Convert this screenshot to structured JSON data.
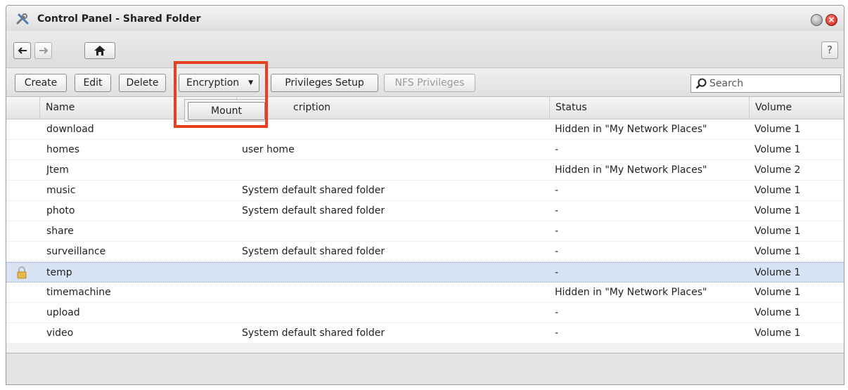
{
  "window": {
    "title": "Control Panel - Shared Folder"
  },
  "navigation": {
    "back": "back",
    "forward": "forward",
    "home": "home",
    "help": "?"
  },
  "toolbar": {
    "create": "Create",
    "edit": "Edit",
    "delete": "Delete",
    "encryption": "Encryption",
    "privileges_setup": "Privileges Setup",
    "nfs_privileges": "NFS Privileges",
    "search_placeholder": "Search"
  },
  "encryption_menu": {
    "mount": "Mount"
  },
  "table": {
    "columns": {
      "name": "Name",
      "description": "Description",
      "description_visible": "cription",
      "status": "Status",
      "volume": "Volume"
    },
    "rows": [
      {
        "name": "download",
        "description": "",
        "status": "Hidden in \"My Network Places\"",
        "volume": "Volume 1"
      },
      {
        "name": "homes",
        "description": "user home",
        "status": "-",
        "volume": "Volume 1"
      },
      {
        "name": "Jtem",
        "description": "",
        "status": "Hidden in \"My Network Places\"",
        "volume": "Volume 2"
      },
      {
        "name": "music",
        "description": "System default shared folder",
        "status": "-",
        "volume": "Volume 1"
      },
      {
        "name": "photo",
        "description": "System default shared folder",
        "status": "-",
        "volume": "Volume 1"
      },
      {
        "name": "share",
        "description": "",
        "status": "-",
        "volume": "Volume 1"
      },
      {
        "name": "surveillance",
        "description": "System default shared folder",
        "status": "-",
        "volume": "Volume 1"
      },
      {
        "name": "temp",
        "description": "",
        "status": "-",
        "volume": "Volume 1",
        "encrypted": true,
        "selected": true
      },
      {
        "name": "timemachine",
        "description": "",
        "status": "Hidden in \"My Network Places\"",
        "volume": "Volume 1"
      },
      {
        "name": "upload",
        "description": "",
        "status": "-",
        "volume": "Volume 1"
      },
      {
        "name": "video",
        "description": "System default shared folder",
        "status": "-",
        "volume": "Volume 1"
      }
    ]
  },
  "colors": {
    "highlight": "#e8401f",
    "selected_row": "#d8e4f3"
  }
}
